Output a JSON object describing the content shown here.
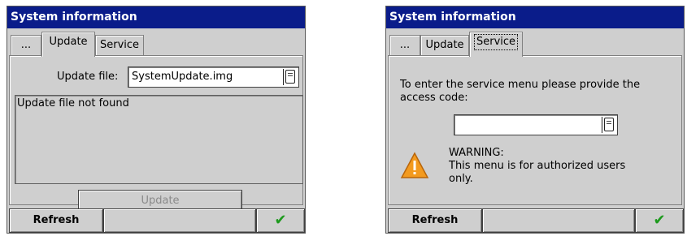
{
  "left": {
    "title": "System information",
    "tabs": [
      "...",
      "Update",
      "Service"
    ],
    "update_file_label": "Update file:",
    "update_file_value": "SystemUpdate.img",
    "status_text": "Update file not found",
    "update_button": "Update",
    "refresh_button": "Refresh",
    "ok_icon": "check-icon"
  },
  "right": {
    "title": "System information",
    "tabs": [
      "...",
      "Update",
      "Service"
    ],
    "prompt_line1": "To enter the service menu please provide the",
    "prompt_line2": "access code:",
    "access_code_value": "",
    "warning_title": "WARNING:",
    "warning_line1": "This menu is for authorized users",
    "warning_line2": "only.",
    "warning_icon": "warning-icon",
    "refresh_button": "Refresh",
    "ok_icon": "check-icon"
  },
  "colors": {
    "titlebar": "#0a1c8a",
    "window_bg": "#cfcfcf",
    "check": "#1d9a1d",
    "warning": "#f39a1e"
  }
}
